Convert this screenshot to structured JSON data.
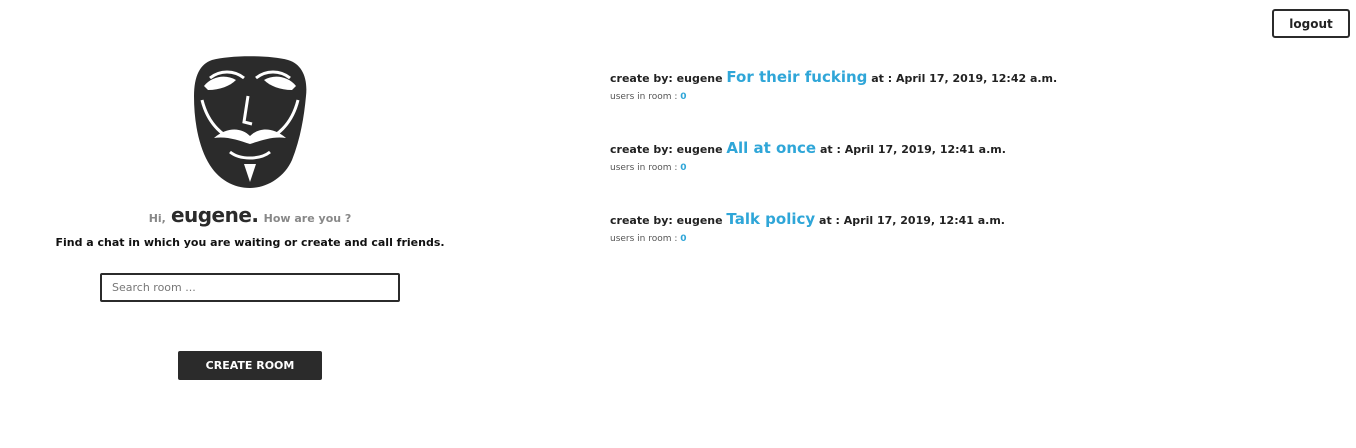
{
  "header": {
    "logout_label": "logout"
  },
  "profile": {
    "mask_icon": "guy-fawkes-mask-icon",
    "hi": "Hi,",
    "username": "eugene.",
    "how_are_you": "How are you ?",
    "subtitle": "Find a chat in which you are waiting or create and call friends."
  },
  "search": {
    "value": "",
    "placeholder": "Search room ..."
  },
  "actions": {
    "create_room_label": "CREATE ROOM"
  },
  "rooms": [
    {
      "created_by_label": "create by: eugene",
      "title": "For their fucking",
      "at_label": "at : April 17, 2019, 12:42 a.m.",
      "users_label": "users in room :",
      "users_count": "0"
    },
    {
      "created_by_label": "create by: eugene",
      "title": "All at once",
      "at_label": "at : April 17, 2019, 12:41 a.m.",
      "users_label": "users in room :",
      "users_count": "0"
    },
    {
      "created_by_label": "create by: eugene",
      "title": "Talk policy",
      "at_label": "at : April 17, 2019, 12:41 a.m.",
      "users_label": "users in room :",
      "users_count": "0"
    }
  ],
  "colors": {
    "accent": "#2fa6d8",
    "dark": "#2b2b2b"
  }
}
